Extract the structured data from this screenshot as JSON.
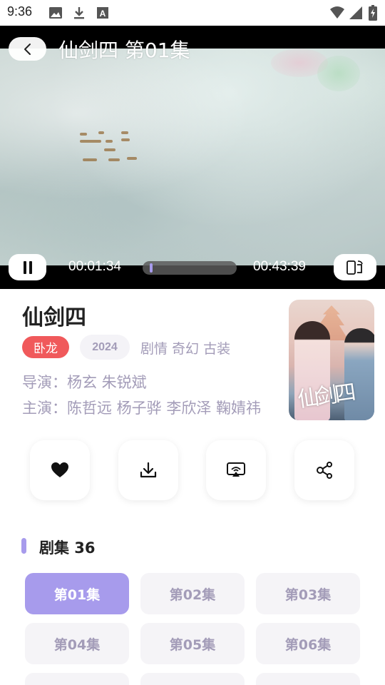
{
  "status_bar": {
    "time": "9:36",
    "icons": [
      "image-icon",
      "download-icon",
      "a-icon",
      "wifi-icon",
      "signal-icon",
      "battery-icon"
    ]
  },
  "player": {
    "title": "仙剑四 第01集",
    "current_time": "00:01:34",
    "total_time": "00:43:39",
    "progress_fraction": 0.036,
    "accent_color": "#a79bec"
  },
  "show": {
    "title": "仙剑四",
    "tag": "卧龙",
    "year": "2024",
    "genres": "剧情 奇幻 古装",
    "director": "导演：杨玄 朱锐斌",
    "cast": "主演：陈哲远 杨子骅 李欣泽 鞠婧祎"
  },
  "actions": [
    {
      "name": "favorite-button",
      "icon": "heart-icon"
    },
    {
      "name": "download-button",
      "icon": "download-icon"
    },
    {
      "name": "cast-button",
      "icon": "screen-cast-icon"
    },
    {
      "name": "share-button",
      "icon": "share-icon"
    }
  ],
  "episodes": {
    "header": "剧集 36",
    "items": [
      "第01集",
      "第02集",
      "第03集",
      "第04集",
      "第05集",
      "第06集",
      "",
      "",
      ""
    ],
    "active_index": 0
  },
  "colors": {
    "accent": "#a79bec",
    "tag_red": "#f0595b",
    "muted_text": "#a39cb8"
  }
}
